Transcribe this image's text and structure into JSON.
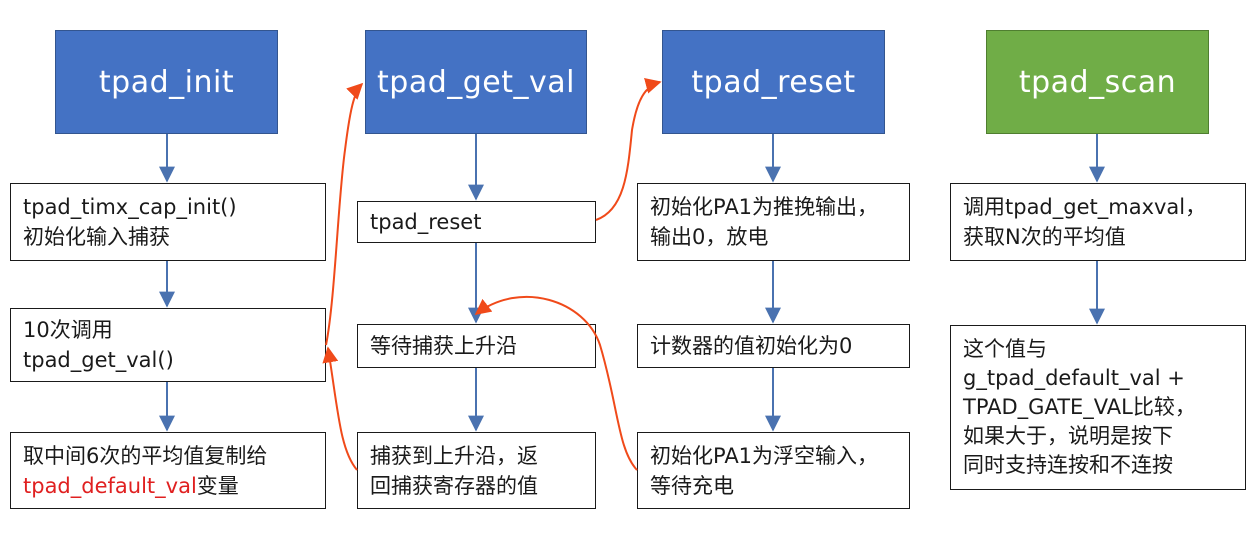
{
  "colors": {
    "header_blue": "#4472c4",
    "header_green": "#70ad47",
    "arrow_blue": "#4a72b0",
    "arrow_red": "#f04a1a",
    "highlight_red": "#e02020"
  },
  "columns": [
    {
      "id": "tpad_init",
      "title": "tpad_init",
      "steps": [
        {
          "lines": [
            "tpad_timx_cap_init()",
            "初始化输入捕获"
          ]
        },
        {
          "lines": [
            "10次调用",
            "tpad_get_val()"
          ]
        },
        {
          "line1": "取中间6次的平均值复制给",
          "line2_red": "tpad_default_val",
          "line2_rest": "变量"
        }
      ]
    },
    {
      "id": "tpad_get_val",
      "title": "tpad_get_val",
      "steps": [
        {
          "lines": [
            "tpad_reset"
          ]
        },
        {
          "lines": [
            "等待捕获上升沿"
          ]
        },
        {
          "lines": [
            "捕获到上升沿，返",
            "回捕获寄存器的值"
          ]
        }
      ]
    },
    {
      "id": "tpad_reset",
      "title": "tpad_reset",
      "steps": [
        {
          "lines": [
            "初始化PA1为推挽输出，",
            "输出0，放电"
          ]
        },
        {
          "lines": [
            "计数器的值初始化为0"
          ]
        },
        {
          "lines": [
            "初始化PA1为浮空输入，",
            "等待充电"
          ]
        }
      ]
    },
    {
      "id": "tpad_scan",
      "title": "tpad_scan",
      "steps": [
        {
          "lines": [
            "调用tpad_get_maxval，",
            "获取N次的平均值"
          ]
        },
        {
          "lines": [
            "这个值与",
            "g_tpad_default_val +",
            "TPAD_GATE_VAL比较，",
            "如果大于，说明是按下",
            "同时支持连按和不连按"
          ]
        }
      ]
    }
  ]
}
